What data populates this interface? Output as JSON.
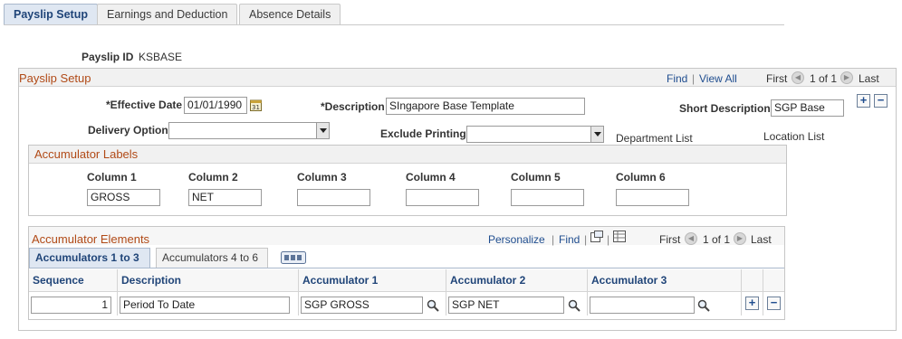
{
  "tabs": [
    {
      "label": "Payslip Setup"
    },
    {
      "label": "Earnings and Deduction"
    },
    {
      "label": "Absence Details"
    }
  ],
  "payslip_id": {
    "label": "Payslip ID",
    "value": "KSBASE"
  },
  "setup": {
    "title": "Payslip Setup",
    "find": "Find",
    "view_all": "View All",
    "first": "First",
    "count": "1 of 1",
    "last": "Last",
    "effective_date_label": "*Effective Date",
    "effective_date": "01/01/1990",
    "description_label": "*Description",
    "description": "SIngapore Base Template",
    "short_description_label": "Short Description",
    "short_description": "SGP Base",
    "delivery_option_label": "Delivery Option",
    "delivery_option": "",
    "exclude_printing_label": "Exclude Printing",
    "exclude_printing": "",
    "department_list": "Department List",
    "location_list": "Location List"
  },
  "labels": {
    "title": "Accumulator Labels",
    "columns": [
      {
        "header": "Column 1",
        "value": "GROSS"
      },
      {
        "header": "Column 2",
        "value": "NET"
      },
      {
        "header": "Column 3",
        "value": ""
      },
      {
        "header": "Column 4",
        "value": ""
      },
      {
        "header": "Column 5",
        "value": ""
      },
      {
        "header": "Column 6",
        "value": ""
      }
    ]
  },
  "elements": {
    "title": "Accumulator Elements",
    "personalize": "Personalize",
    "find": "Find",
    "first": "First",
    "count": "1 of 1",
    "last": "Last",
    "subtabs": [
      {
        "label": "Accumulators 1 to 3"
      },
      {
        "label": "Accumulators 4 to 6"
      }
    ],
    "headers": [
      "Sequence",
      "Description",
      "Accumulator 1",
      "Accumulator 2",
      "Accumulator 3"
    ],
    "rows": [
      {
        "sequence": "1",
        "description": "Period To Date",
        "acc1": "SGP GROSS",
        "acc2": "SGP NET",
        "acc3": ""
      }
    ]
  },
  "icons": {
    "calendar": "calendar-icon",
    "lookup": "magnifier-icon",
    "add": "plus-icon",
    "delete": "minus-icon",
    "zoom": "view-window-icon",
    "download": "spreadsheet-icon",
    "show_all_columns": "show-all-columns-icon"
  },
  "colors": {
    "section_title": "#b14a17",
    "link": "#1f4d8f",
    "tab_active_bg": "#dfe7f2"
  }
}
